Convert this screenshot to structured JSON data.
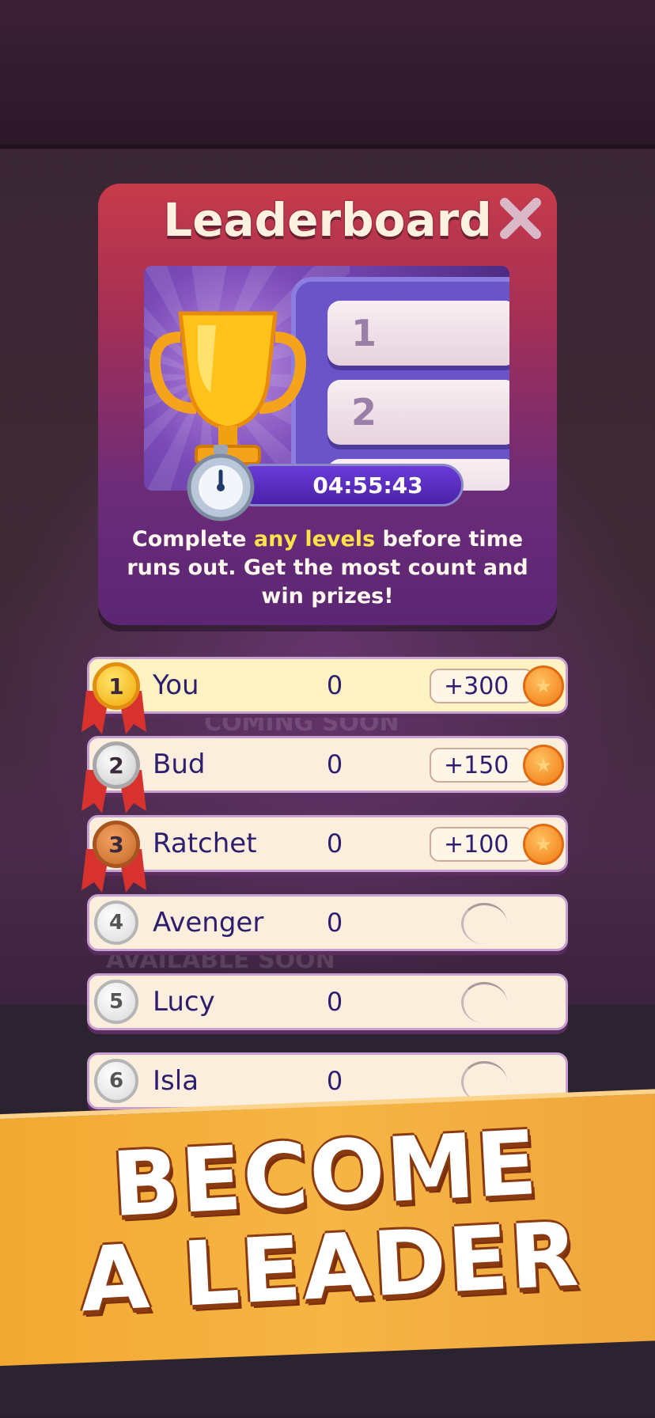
{
  "leaderboard": {
    "title": "Leaderboard",
    "banner_slots": [
      "1",
      "2"
    ],
    "timer": "04:55:43",
    "description_parts": [
      "Complete ",
      "any levels",
      " before time runs out. Get the most count and win prizes!"
    ]
  },
  "rows": [
    {
      "rank": "1",
      "name": "You",
      "score": "0",
      "prize": "+300",
      "medal": "gold"
    },
    {
      "rank": "2",
      "name": "Bud",
      "score": "0",
      "prize": "+150",
      "medal": "silver"
    },
    {
      "rank": "3",
      "name": "Ratchet",
      "score": "0",
      "prize": "+100",
      "medal": "bronze"
    },
    {
      "rank": "4",
      "name": "Avenger",
      "score": "0",
      "prize": ""
    },
    {
      "rank": "5",
      "name": "Lucy",
      "score": "0",
      "prize": ""
    },
    {
      "rank": "6",
      "name": "Isla",
      "score": "0",
      "prize": ""
    }
  ],
  "promo": {
    "line1": "BECOME",
    "line2": "A LEADER"
  },
  "background_text": [
    "COMING SOON",
    "AVAILABLE SOON"
  ],
  "colors": {
    "accent": "#ffe14a",
    "card_top": "#c73b4a",
    "card_bottom": "#5b2673",
    "promo": "#f2a830"
  }
}
